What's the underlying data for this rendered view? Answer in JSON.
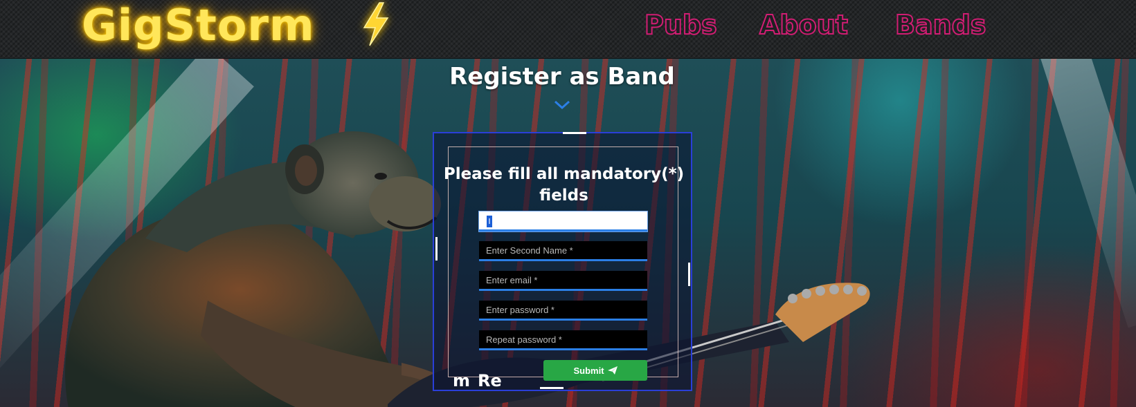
{
  "header": {
    "logo_text": "GigStorm",
    "nav": {
      "pubs": "Pubs",
      "about": "About",
      "bands": "Bands"
    }
  },
  "page": {
    "title": "Register as Band"
  },
  "form": {
    "heading": "Please fill all mandatory(*) fields",
    "first_name_value": "",
    "second_name_placeholder": "Enter Second Name *",
    "email_placeholder": "Enter email *",
    "password_placeholder": "Enter password *",
    "repeat_password_placeholder": "Repeat password *",
    "submit_label": "Submit",
    "stray_text_1": "m",
    "stray_text_2": "Re"
  },
  "colors": {
    "logo": "#ffe65a",
    "nav_accent": "#d11d73",
    "form_border": "#2a3fd9",
    "field_underline": "#2b7fe6",
    "submit": "#28a745"
  },
  "icons": {
    "logo_bolt": "lightning-bolt-icon",
    "title_chevron": "chevron-down-icon",
    "submit": "paper-plane-icon"
  }
}
